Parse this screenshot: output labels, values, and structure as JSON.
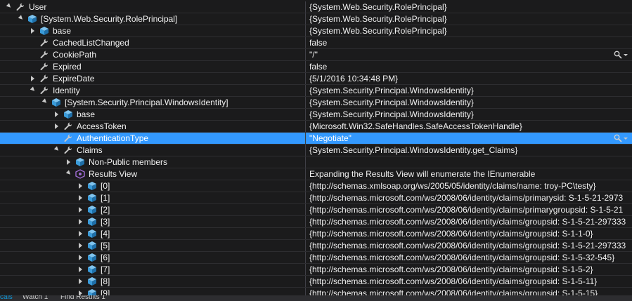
{
  "rows": [
    {
      "name": "User",
      "value": "{System.Web.Security.RolePrincipal}",
      "level": 0,
      "expander": "expanded",
      "icon": "wrench"
    },
    {
      "name": "[System.Web.Security.RolePrincipal]",
      "value": "{System.Web.Security.RolePrincipal}",
      "level": 1,
      "expander": "expanded",
      "icon": "cube"
    },
    {
      "name": "base",
      "value": "{System.Web.Security.RolePrincipal}",
      "level": 2,
      "expander": "collapsed",
      "icon": "cube"
    },
    {
      "name": "CachedListChanged",
      "value": "false",
      "level": 2,
      "expander": "none",
      "icon": "wrench"
    },
    {
      "name": "CookiePath",
      "value": "\"/\"",
      "level": 2,
      "expander": "none",
      "icon": "wrench",
      "tools": true
    },
    {
      "name": "Expired",
      "value": "false",
      "level": 2,
      "expander": "none",
      "icon": "wrench"
    },
    {
      "name": "ExpireDate",
      "value": "{5/1/2016 10:34:48 PM}",
      "level": 2,
      "expander": "collapsed",
      "icon": "wrench"
    },
    {
      "name": "Identity",
      "value": "{System.Security.Principal.WindowsIdentity}",
      "level": 2,
      "expander": "expanded",
      "icon": "wrench"
    },
    {
      "name": "[System.Security.Principal.WindowsIdentity]",
      "value": "{System.Security.Principal.WindowsIdentity}",
      "level": 3,
      "expander": "expanded",
      "icon": "cube"
    },
    {
      "name": "base",
      "value": "{System.Security.Principal.WindowsIdentity}",
      "level": 4,
      "expander": "collapsed",
      "icon": "cube"
    },
    {
      "name": "AccessToken",
      "value": "{Microsoft.Win32.SafeHandles.SafeAccessTokenHandle}",
      "level": 4,
      "expander": "collapsed",
      "icon": "wrench"
    },
    {
      "name": "AuthenticationType",
      "value": "\"Negotiate\"",
      "level": 4,
      "expander": "none",
      "icon": "wrench",
      "tools": true,
      "selected": true
    },
    {
      "name": "Claims",
      "value": "{System.Security.Principal.WindowsIdentity.get_Claims}",
      "level": 4,
      "expander": "expanded",
      "icon": "wrench"
    },
    {
      "name": "Non-Public members",
      "value": "",
      "level": 5,
      "expander": "collapsed",
      "icon": "cube"
    },
    {
      "name": "Results View",
      "value": "Expanding the Results View will enumerate the IEnumerable",
      "level": 5,
      "expander": "expanded",
      "icon": "results"
    },
    {
      "name": "[0]",
      "value": "{http://schemas.xmlsoap.org/ws/2005/05/identity/claims/name: troy-PC\\testy}",
      "level": 6,
      "expander": "collapsed",
      "icon": "cube"
    },
    {
      "name": "[1]",
      "value": "{http://schemas.microsoft.com/ws/2008/06/identity/claims/primarysid: S-1-5-21-2973",
      "level": 6,
      "expander": "collapsed",
      "icon": "cube"
    },
    {
      "name": "[2]",
      "value": "{http://schemas.microsoft.com/ws/2008/06/identity/claims/primarygroupsid: S-1-5-21",
      "level": 6,
      "expander": "collapsed",
      "icon": "cube"
    },
    {
      "name": "[3]",
      "value": "{http://schemas.microsoft.com/ws/2008/06/identity/claims/groupsid: S-1-5-21-297333",
      "level": 6,
      "expander": "collapsed",
      "icon": "cube"
    },
    {
      "name": "[4]",
      "value": "{http://schemas.microsoft.com/ws/2008/06/identity/claims/groupsid: S-1-1-0}",
      "level": 6,
      "expander": "collapsed",
      "icon": "cube"
    },
    {
      "name": "[5]",
      "value": "{http://schemas.microsoft.com/ws/2008/06/identity/claims/groupsid: S-1-5-21-297333",
      "level": 6,
      "expander": "collapsed",
      "icon": "cube"
    },
    {
      "name": "[6]",
      "value": "{http://schemas.microsoft.com/ws/2008/06/identity/claims/groupsid: S-1-5-32-545}",
      "level": 6,
      "expander": "collapsed",
      "icon": "cube"
    },
    {
      "name": "[7]",
      "value": "{http://schemas.microsoft.com/ws/2008/06/identity/claims/groupsid: S-1-5-2}",
      "level": 6,
      "expander": "collapsed",
      "icon": "cube"
    },
    {
      "name": "[8]",
      "value": "{http://schemas.microsoft.com/ws/2008/06/identity/claims/groupsid: S-1-5-11}",
      "level": 6,
      "expander": "collapsed",
      "icon": "cube"
    },
    {
      "name": "[9]",
      "value": "{http://schemas.microsoft.com/ws/2008/06/identity/claims/groupsid: S-1-5-15}",
      "level": 6,
      "expander": "collapsed",
      "icon": "cube"
    }
  ],
  "bottom_tabs": [
    "cals",
    "Watch 1",
    "Find Results 1"
  ],
  "colors": {
    "background": "#1b1b1c",
    "selection": "#3399ff",
    "cube_icon": "#3a9bd9",
    "wrench_icon": "#c8c8c8",
    "results_icon": "#a06cd5",
    "active_tab": "#0e97d8"
  }
}
